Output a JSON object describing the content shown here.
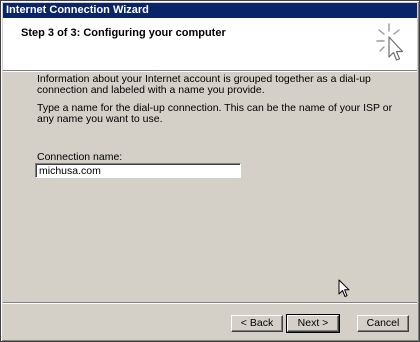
{
  "window": {
    "title": "Internet Connection Wizard"
  },
  "header": {
    "step_title": "Step 3 of 3: Configuring your computer"
  },
  "body": {
    "paragraph1": "Information about your Internet account is grouped together as a dial-up connection and labeled with a name you provide.",
    "paragraph2": "Type a name for the dial-up connection. This can be the name of your ISP or any name you want to use.",
    "connection_name_label": "Connection name:",
    "connection_name_value": "michusa.com"
  },
  "buttons": {
    "back": "< Back",
    "next": "Next >",
    "cancel": "Cancel"
  },
  "colors": {
    "titlebar": "#0a246a",
    "dialog_face": "#d4d0c8",
    "header_bg": "#ffffff"
  },
  "icons": {
    "header": "wizard-sparkle-cursor-icon",
    "pointer": "mouse-pointer-icon"
  }
}
